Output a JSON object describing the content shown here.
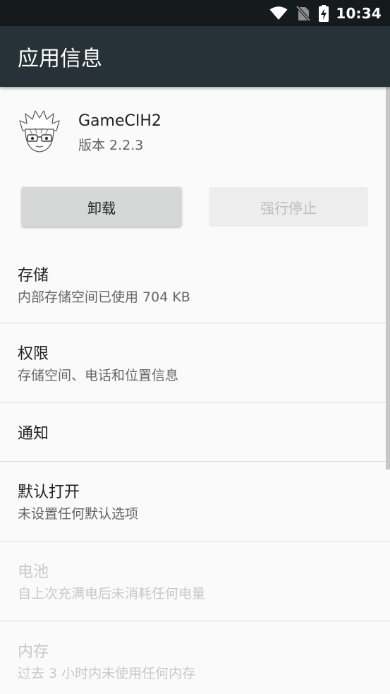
{
  "status_bar": {
    "time": "10:34",
    "icons": [
      "wifi-icon",
      "no-sim-icon",
      "battery-charging-icon"
    ]
  },
  "app_bar": {
    "title": "应用信息"
  },
  "app": {
    "name": "GameCIH2",
    "version": "版本 2.2.3",
    "icon": "anime-avatar-icon"
  },
  "buttons": {
    "uninstall": "卸载",
    "force_stop": "强行停止"
  },
  "items": [
    {
      "title": "存储",
      "summary": "内部存储空间已使用 704 KB",
      "enabled": true
    },
    {
      "title": "权限",
      "summary": "存储空间、电话和位置信息",
      "enabled": true
    },
    {
      "title": "通知",
      "summary": "",
      "enabled": true
    },
    {
      "title": "默认打开",
      "summary": "未设置任何默认选项",
      "enabled": true
    },
    {
      "title": "电池",
      "summary": "自上次充满电后未消耗任何电量",
      "enabled": false
    },
    {
      "title": "内存",
      "summary": "过去 3 小时内未使用任何内存",
      "enabled": false
    }
  ],
  "colors": {
    "status_bar": "#151a1d",
    "app_bar": "#263238",
    "background": "#fafafa",
    "disabled_text": "#c8c8c8"
  }
}
